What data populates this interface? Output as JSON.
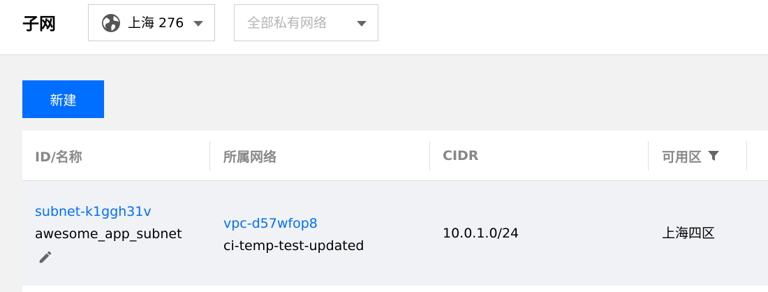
{
  "header": {
    "title": "子网",
    "region_select": {
      "icon": "globe-icon",
      "value": "上海 276"
    },
    "vpc_select": {
      "placeholder": "全部私有网络"
    }
  },
  "toolbar": {
    "new_label": "新建"
  },
  "table": {
    "columns": [
      "ID/名称",
      "所属网络",
      "CIDR",
      "可用区"
    ],
    "rows": [
      {
        "subnet_id": "subnet-k1ggh31v",
        "subnet_name": "awesome_app_subnet",
        "vpc_id": "vpc-d57wfop8",
        "vpc_name": "ci-temp-test-updated",
        "cidr": "10.0.1.0/24",
        "zone": "上海四区"
      }
    ]
  },
  "colors": {
    "accent": "#006eff",
    "row_bg": "#f0f2f5",
    "page_bg": "#f2f2f2"
  }
}
